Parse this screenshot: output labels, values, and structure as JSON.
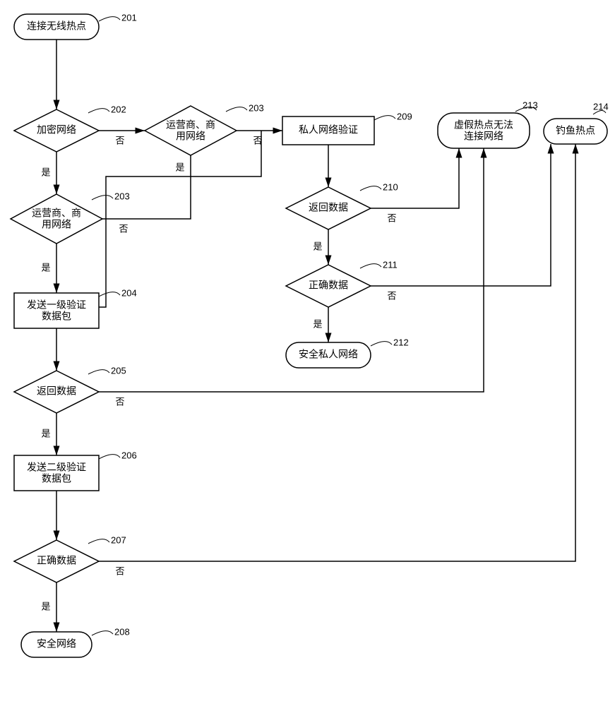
{
  "nodes": {
    "n201": {
      "label": "连接无线热点",
      "num": "201"
    },
    "n202": {
      "label": "加密网络",
      "num": "202"
    },
    "n203a": {
      "label1": "运营商、商",
      "label2": "用网络",
      "num": "203"
    },
    "n203b": {
      "label1": "运营商、商",
      "label2": "用网络",
      "num": "203"
    },
    "n204": {
      "label1": "发送一级验证",
      "label2": "数据包",
      "num": "204"
    },
    "n205": {
      "label": "返回数据",
      "num": "205"
    },
    "n206": {
      "label1": "发送二级验证",
      "label2": "数据包",
      "num": "206"
    },
    "n207": {
      "label": "正确数据",
      "num": "207"
    },
    "n208": {
      "label": "安全网络",
      "num": "208"
    },
    "n209": {
      "label": "私人网络验证",
      "num": "209"
    },
    "n210": {
      "label": "返回数据",
      "num": "210"
    },
    "n211": {
      "label": "正确数据",
      "num": "211"
    },
    "n212": {
      "label": "安全私人网络",
      "num": "212"
    },
    "n213": {
      "label1": "虚假热点无法",
      "label2": "连接网络",
      "num": "213"
    },
    "n214": {
      "label": "钓鱼热点",
      "num": "214"
    }
  },
  "edges": {
    "yes": "是",
    "no": "否"
  }
}
